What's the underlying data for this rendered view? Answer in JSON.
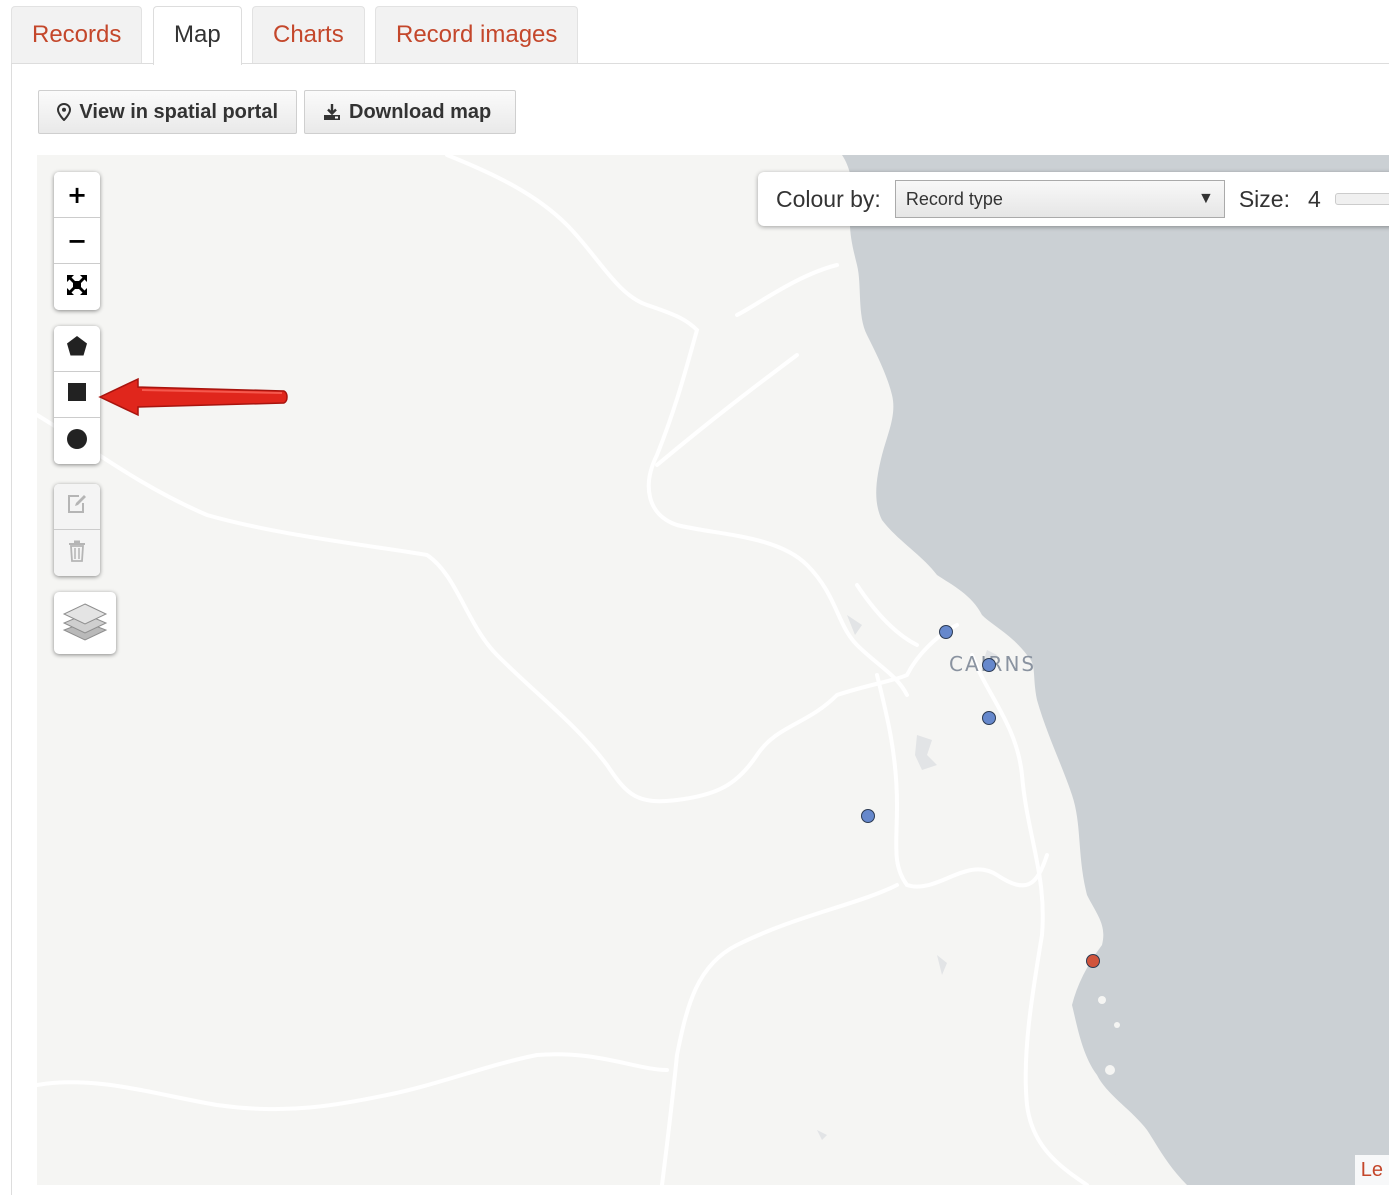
{
  "tabs": [
    {
      "label": "Records",
      "active": false
    },
    {
      "label": "Map",
      "active": true
    },
    {
      "label": "Charts",
      "active": false
    },
    {
      "label": "Record images",
      "active": false
    }
  ],
  "toolbar": {
    "view_spatial_label": "View in spatial portal",
    "download_map_label": "Download map"
  },
  "map": {
    "zoom_in": "+",
    "zoom_out": "−",
    "colour_by_label": "Colour by:",
    "colour_by_value": "Record type",
    "size_label": "Size:",
    "size_value": "4",
    "place_label": "CAIRNS",
    "attribution": "Le",
    "colors": {
      "land": "#f5f5f3",
      "sea": "#cbd0d4",
      "road": "#ffffff",
      "point_blue": "#6688cc",
      "point_red": "#d0543c",
      "arrow": "#e0261c"
    },
    "points": [
      {
        "color": "point_blue",
        "record_type": "blue"
      },
      {
        "color": "point_blue",
        "record_type": "blue"
      },
      {
        "color": "point_blue",
        "record_type": "blue"
      },
      {
        "color": "point_blue",
        "record_type": "blue"
      },
      {
        "color": "point_red",
        "record_type": "red"
      }
    ]
  },
  "icons": {
    "view_spatial": "map-marker-icon",
    "download_map": "download-icon",
    "fit_bounds": "fullscreen-icon",
    "draw_polygon": "pentagon-icon",
    "draw_rectangle": "square-icon",
    "draw_circle": "circle-icon",
    "edit": "edit-icon",
    "delete": "trash-icon",
    "layers": "layers-icon",
    "annotation": "red-arrow-icon"
  }
}
